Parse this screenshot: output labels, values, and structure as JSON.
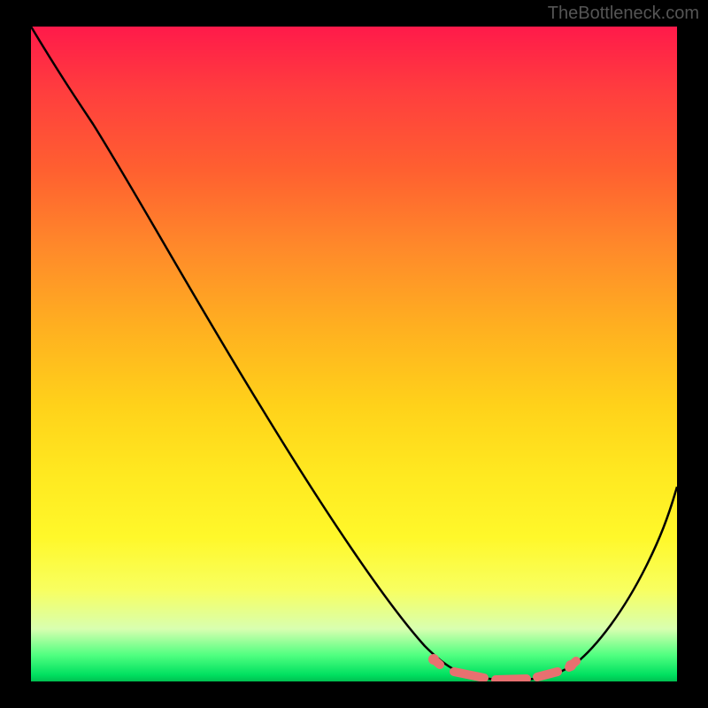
{
  "watermark": "TheBottleneck.com",
  "chart_data": {
    "type": "line",
    "title": "",
    "xlabel": "",
    "ylabel": "",
    "xlim": [
      0,
      100
    ],
    "ylim": [
      0,
      100
    ],
    "series": [
      {
        "name": "bottleneck-curve",
        "x": [
          0,
          5,
          10,
          15,
          20,
          25,
          30,
          35,
          40,
          45,
          50,
          55,
          60,
          62,
          65,
          68,
          70,
          72,
          75,
          78,
          80,
          82,
          85,
          88,
          90,
          92,
          95,
          100
        ],
        "values": [
          100,
          94,
          87,
          80,
          73,
          66,
          59,
          52,
          45,
          38,
          31,
          24,
          17,
          13,
          8,
          4,
          2,
          1,
          0,
          0,
          0,
          1,
          3,
          7,
          11,
          15,
          21,
          33
        ]
      }
    ],
    "markers": {
      "name": "highlight-dots",
      "color": "#e87070",
      "points": [
        {
          "x": 63,
          "y": 3
        },
        {
          "x": 67,
          "y": 1.5
        },
        {
          "x": 70,
          "y": 1
        },
        {
          "x": 73,
          "y": 0.5
        },
        {
          "x": 77,
          "y": 0.5
        },
        {
          "x": 80,
          "y": 1
        },
        {
          "x": 83,
          "y": 2.5
        }
      ]
    },
    "gradient_stops": [
      {
        "pos": 0,
        "color": "#ff1a4a"
      },
      {
        "pos": 50,
        "color": "#ffe020"
      },
      {
        "pos": 90,
        "color": "#f0ff80"
      },
      {
        "pos": 100,
        "color": "#00c050"
      }
    ]
  }
}
